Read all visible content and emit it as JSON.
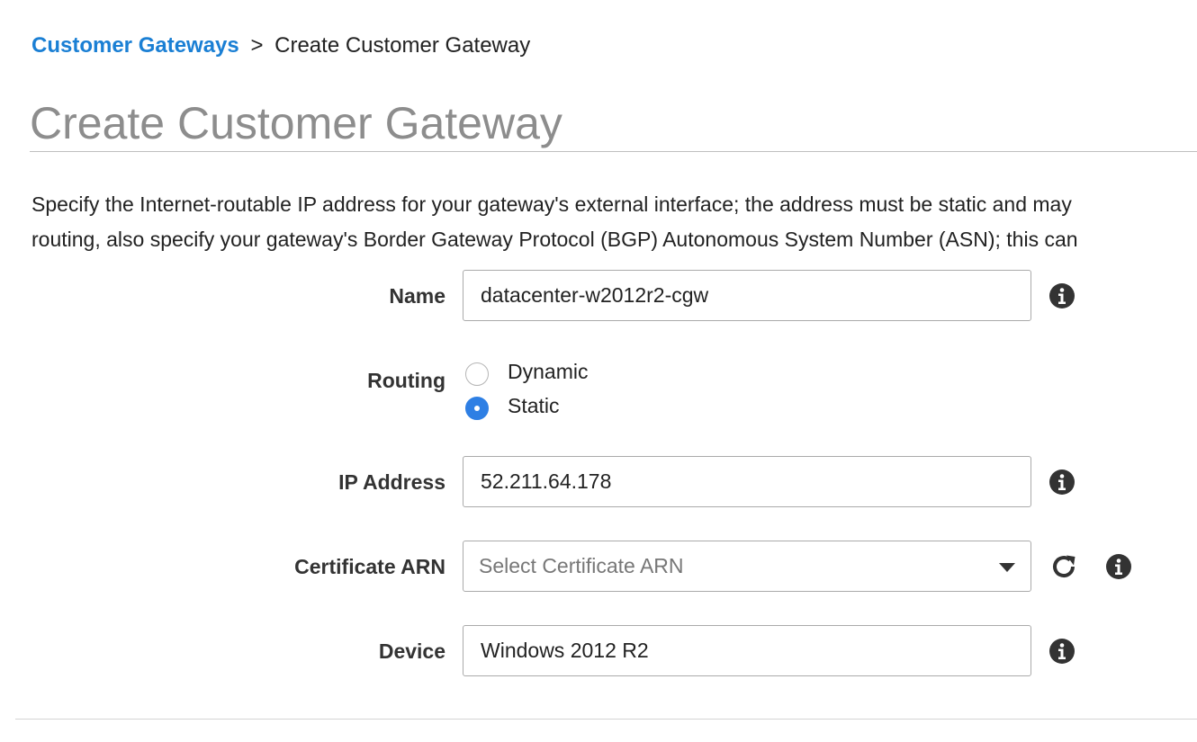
{
  "breadcrumb": {
    "parent": "Customer Gateways",
    "separator": ">",
    "current": "Create Customer Gateway"
  },
  "page_title": "Create Customer Gateway",
  "description": {
    "line1": "Specify the Internet-routable IP address for your gateway's external interface; the address must be static and may",
    "line2": "routing, also specify your gateway's Border Gateway Protocol (BGP) Autonomous System Number (ASN); this can"
  },
  "form": {
    "name": {
      "label": "Name",
      "value": "datacenter-w2012r2-cgw"
    },
    "routing": {
      "label": "Routing",
      "options": [
        {
          "label": "Dynamic",
          "checked": false
        },
        {
          "label": "Static",
          "checked": true
        }
      ]
    },
    "ip_address": {
      "label": "IP Address",
      "value": "52.211.64.178"
    },
    "certificate_arn": {
      "label": "Certificate ARN",
      "placeholder": "Select Certificate ARN"
    },
    "device": {
      "label": "Device",
      "value": "Windows 2012 R2"
    }
  },
  "icons": {
    "info": "info-icon",
    "refresh": "refresh-icon",
    "dropdown": "chevron-down-icon"
  },
  "colors": {
    "link": "#1a7fd4",
    "title": "#8d8d8d",
    "radio_selected": "#2e7fe4"
  }
}
